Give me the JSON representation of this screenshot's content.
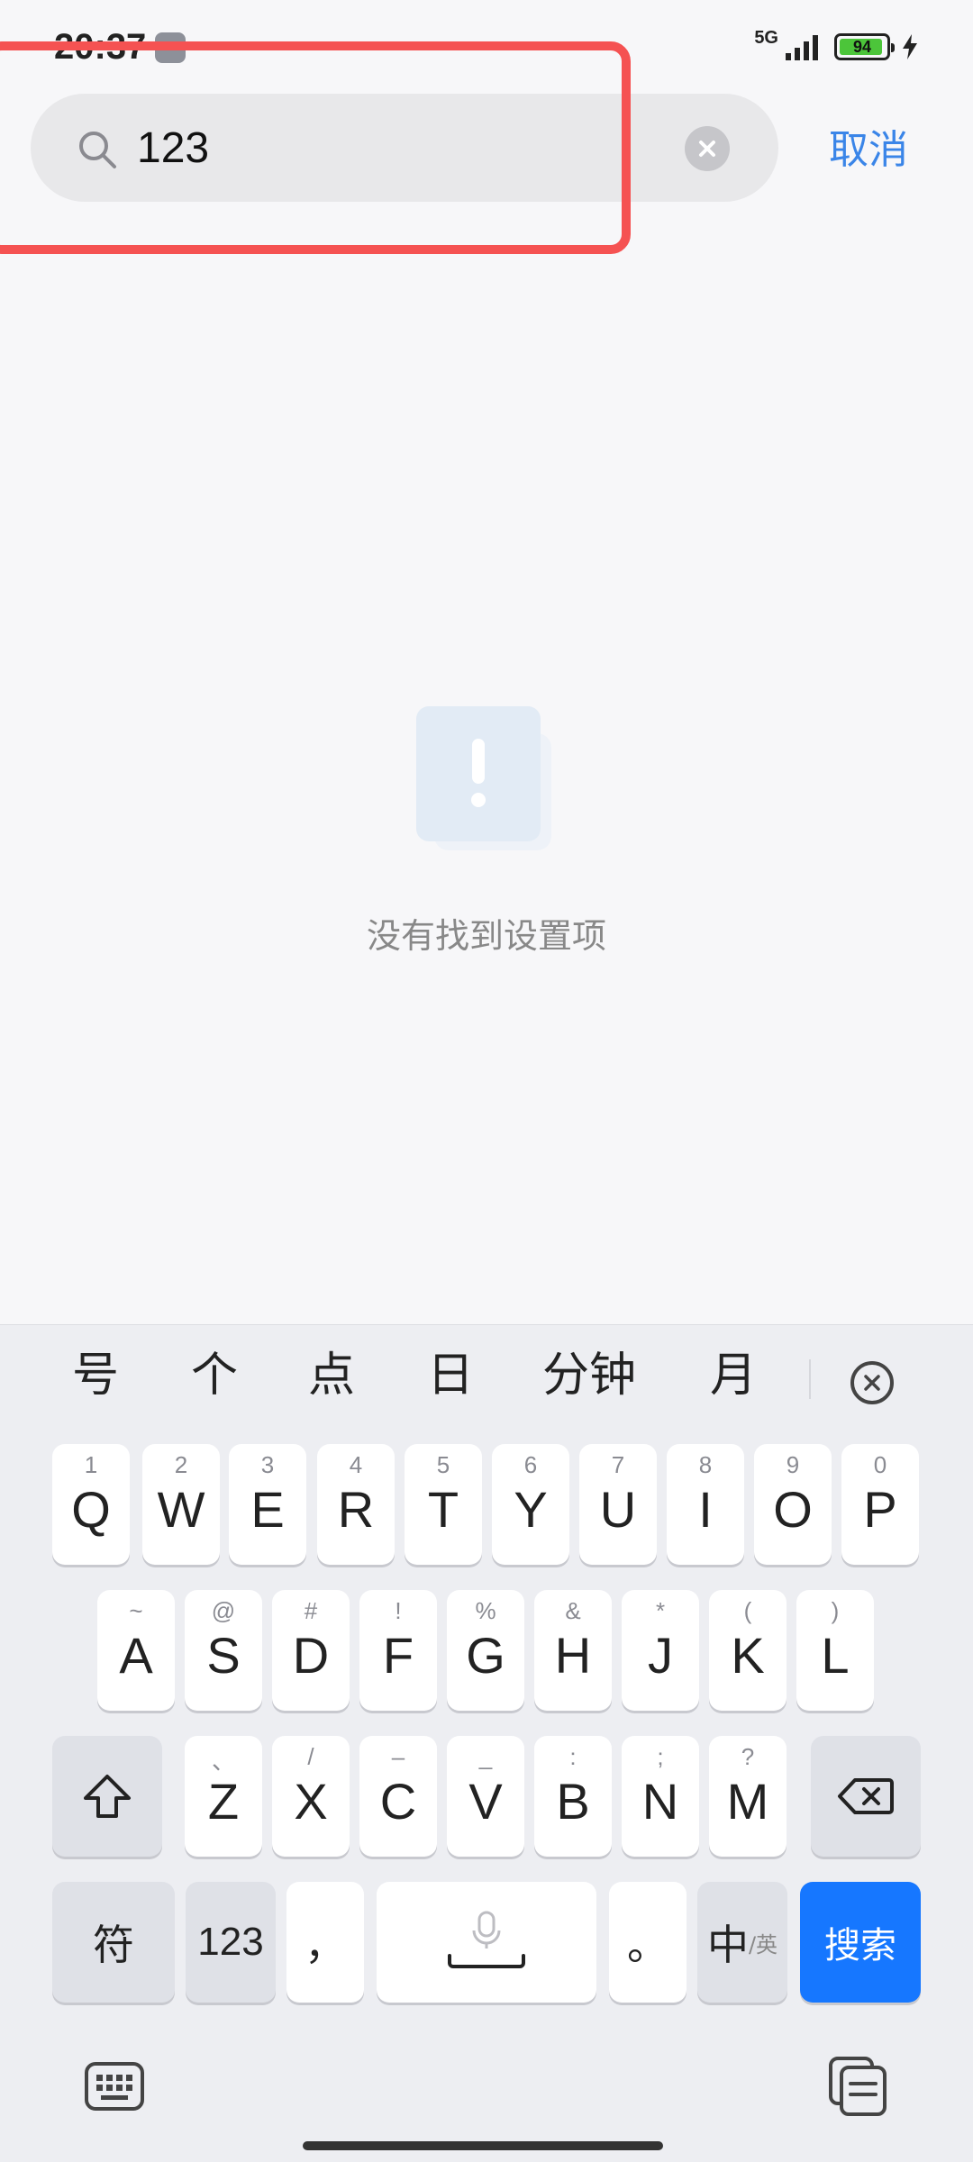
{
  "status_bar": {
    "time": "20:37",
    "network": "5G",
    "battery_level": "94",
    "battery_fraction": 0.94,
    "battery_color": "#4cc53a"
  },
  "search": {
    "query": "123",
    "cancel_label": "取消"
  },
  "empty_state": {
    "message": "没有找到设置项"
  },
  "keyboard": {
    "candidates": [
      "号",
      "个",
      "点",
      "日",
      "分钟",
      "月"
    ],
    "row1": [
      {
        "key": "Q",
        "hint": "1"
      },
      {
        "key": "W",
        "hint": "2"
      },
      {
        "key": "E",
        "hint": "3"
      },
      {
        "key": "R",
        "hint": "4"
      },
      {
        "key": "T",
        "hint": "5"
      },
      {
        "key": "Y",
        "hint": "6"
      },
      {
        "key": "U",
        "hint": "7"
      },
      {
        "key": "I",
        "hint": "8"
      },
      {
        "key": "O",
        "hint": "9"
      },
      {
        "key": "P",
        "hint": "0"
      }
    ],
    "row2": [
      {
        "key": "A",
        "hint": "~"
      },
      {
        "key": "S",
        "hint": "@"
      },
      {
        "key": "D",
        "hint": "#"
      },
      {
        "key": "F",
        "hint": "!"
      },
      {
        "key": "G",
        "hint": "%"
      },
      {
        "key": "H",
        "hint": "&"
      },
      {
        "key": "J",
        "hint": "*"
      },
      {
        "key": "K",
        "hint": "("
      },
      {
        "key": "L",
        "hint": ")"
      }
    ],
    "row3": [
      {
        "key": "Z",
        "hint": "、"
      },
      {
        "key": "X",
        "hint": "/"
      },
      {
        "key": "C",
        "hint": "–"
      },
      {
        "key": "V",
        "hint": "_"
      },
      {
        "key": "B",
        "hint": ":"
      },
      {
        "key": "N",
        "hint": ";"
      },
      {
        "key": "M",
        "hint": "?"
      }
    ],
    "symbols_label": "符",
    "numbers_label": "123",
    "comma_label": "，",
    "period_label": "。",
    "lang_main": "中",
    "lang_alt": "/英",
    "search_label": "搜索",
    "accent_color": "#1677ff"
  }
}
